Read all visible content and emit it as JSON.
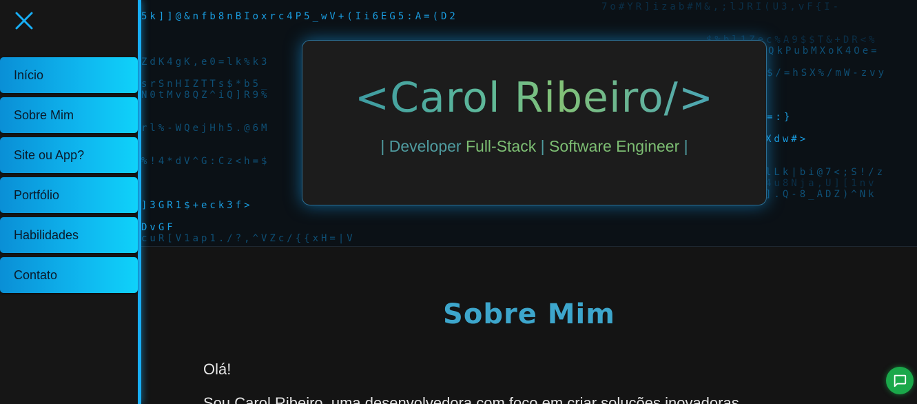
{
  "sidebar": {
    "items": [
      {
        "label": "Início"
      },
      {
        "label": "Sobre Mim"
      },
      {
        "label": "Site ou App?"
      },
      {
        "label": "Portfólio"
      },
      {
        "label": "Habilidades"
      },
      {
        "label": "Contato"
      }
    ]
  },
  "hero": {
    "brand": "<Carol Ribeiro/>",
    "tagline": {
      "sep1": "| Developer ",
      "part1": "Full-Stack",
      "sep2": " | ",
      "part2": "Software Engineer",
      "sep3": " |"
    },
    "matrix_rows": [
      "5k]]@&nfb8nBIoxrc4P5_wV+(Ii6EG5:A=(D2",
      "ZdK4gK,e0=lk%k3",
      "srSnHIZTTs$*b5_",
      "N0tMv8QZ^iQ]R9%",
      "rl%-WQejHh5.@6M",
      "%!4*dV^G:Cz<h=$",
      "]3GR1$+eck3f>",
      "DvGF",
      "cuR[V1ap1./?,^VZc/{{xH=|V",
      "7o#YR]izab#M&,;lJRI(U3,vF{I-",
      "$%bl1Zec%A9$$T&+DR<%",
      "QkPubMXoK4Oe=",
      "$/=hSX%/mW-zvy",
      "=:}",
      "Xdw#>",
      "lLk|bi@7<;S!/z",
      "4u8Nja,U][1nv",
      "].Q-8_ADZ)^Nk"
    ]
  },
  "about": {
    "title": "Sobre Mim",
    "greeting": "Olá!",
    "intro": "Sou Carol Ribeiro, uma desenvolvedora com foco em criar soluções inovadoras"
  },
  "icons": {
    "close": "close-icon",
    "chat": "chat-icon"
  },
  "colors": {
    "accent": "#18aef5",
    "menu_gradient_start": "#0a8fd6",
    "menu_gradient_end": "#0fd2fa",
    "title": "#3da6cc",
    "chat": "#1aa84a"
  }
}
